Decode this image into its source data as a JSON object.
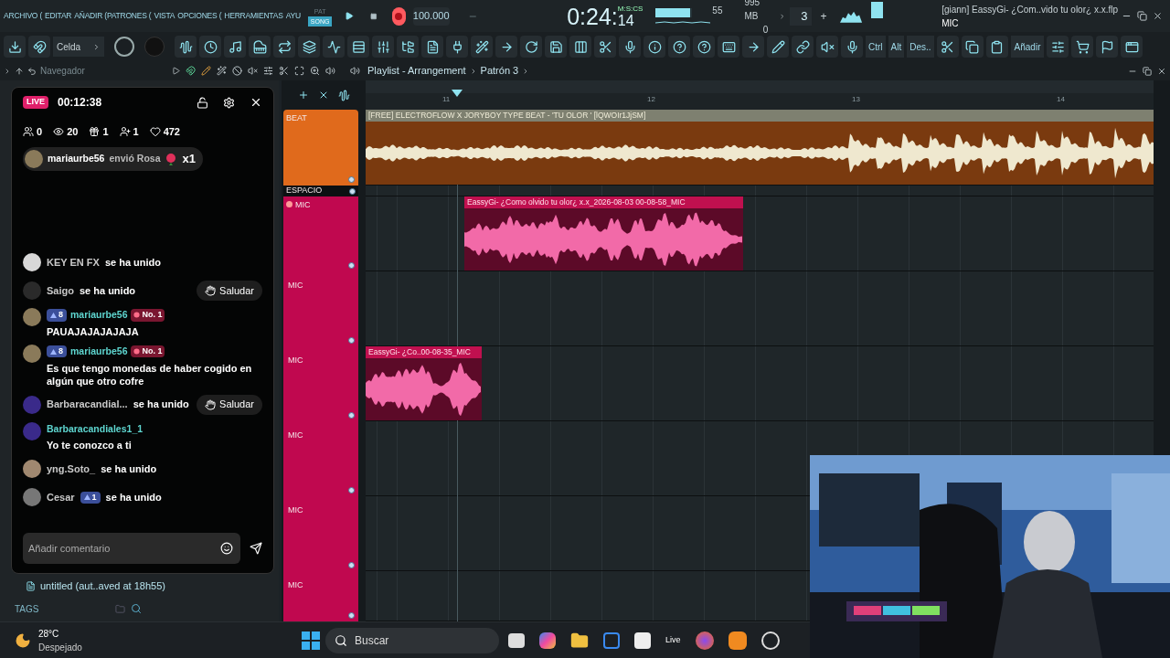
{
  "menu": [
    "ARCHIVO (",
    "EDITAR",
    "AÑADIR (PATRONES (",
    "VISTA",
    "OPCIONES (",
    "HERRAMIENTAS",
    "AYU"
  ],
  "transport": {
    "modes": [
      {
        "label": "PAT",
        "selected": false
      },
      {
        "label": "SONG",
        "selected": true
      }
    ],
    "tempo": "100.000"
  },
  "clock": {
    "time": "0:24:",
    "centis": "14",
    "unit_label": "M:S:CS"
  },
  "cpu": {
    "level": 0.95,
    "value": "55"
  },
  "memory": {
    "value": "995 MB",
    "polyphony": "0"
  },
  "pattern": {
    "number": "3",
    "add": "+"
  },
  "project": {
    "title": "[giann] EassyGi- ¿Com..vido tu olor¿ x.x.flp",
    "hint": "MIC"
  },
  "toolbar": {
    "snap": "Celda",
    "keys": [
      "Ctrl",
      "Alt",
      "Des.."
    ],
    "add": "Añadir"
  },
  "browser": {
    "title": "Navegador",
    "bottom_items": [
      "untitled (aut..aved at 18h55)"
    ],
    "tags": "TAGS"
  },
  "playlist": {
    "title": "Playlist - Arrangement",
    "pattern": "Patrón 3",
    "ruler": [
      "11",
      "12",
      "13",
      "14"
    ],
    "tracks": [
      {
        "name": "BEAT",
        "kind": "audio",
        "color": "#e06a1c",
        "clips": [
          {
            "name": "[FREE] ELECTROFLOW X JORYBOY TYPE BEAT - 'TU OLOR ' [lQWOIr1JjSM]"
          }
        ]
      },
      {
        "name": "ESPACIO",
        "kind": "spacer",
        "color": "#0d1012"
      },
      {
        "name": "MIC",
        "kind": "vocal",
        "color": "#c0084f",
        "clips": [
          {
            "name": "EassyGi- ¿Como olvido tu olor¿ x.x_2026-08-03 00-08-58_MIC"
          }
        ]
      },
      {
        "name": "MIC",
        "kind": "vocal",
        "color": "#c0084f"
      },
      {
        "name": "MIC",
        "kind": "vocal",
        "color": "#c0084f",
        "clips": [
          {
            "name": "EassyGi- ¿Co..00-08-35_MIC"
          }
        ]
      },
      {
        "name": "MIC",
        "kind": "vocal",
        "color": "#c0084f"
      },
      {
        "name": "MIC",
        "kind": "vocal",
        "color": "#c0084f"
      },
      {
        "name": "MIC",
        "kind": "vocal",
        "color": "#c0084f"
      }
    ]
  },
  "live": {
    "badge": "LIVE",
    "duration": "00:12:38",
    "stats": [
      {
        "kind": "members",
        "value": "0"
      },
      {
        "kind": "viewers",
        "value": "20"
      },
      {
        "kind": "gifts",
        "value": "1"
      },
      {
        "kind": "follows",
        "value": "1"
      },
      {
        "kind": "likes",
        "value": "472"
      }
    ],
    "gift": {
      "user": "mariaurbe56",
      "text": "envió Rosa",
      "count": "x1"
    },
    "feed": [
      {
        "kind": "join",
        "user": "KEY EN FX",
        "text": "se ha unido"
      },
      {
        "kind": "join",
        "user": "Saigo",
        "text": "se ha unido",
        "action": "Saludar"
      },
      {
        "kind": "message",
        "user": "mariaurbe56",
        "fan_level": "8",
        "rank": "No. 1",
        "text": "PAUAJAJAJAJAJA"
      },
      {
        "kind": "message",
        "user": "mariaurbe56",
        "fan_level": "8",
        "rank": "No. 1",
        "text": "Es que tengo monedas de haber cogido en algún que otro cofre"
      },
      {
        "kind": "join",
        "user": "Barbaracandial...",
        "text": "se ha unido",
        "action": "Saludar"
      },
      {
        "kind": "message",
        "user": "Barbaracandiales1_1",
        "text": "Yo te conozco a ti"
      },
      {
        "kind": "join",
        "user": "yng.Soto_",
        "text": "se ha unido"
      },
      {
        "kind": "join",
        "user": "Cesar",
        "fan_level": "1",
        "text": "se ha unido"
      }
    ],
    "comment": {
      "placeholder": "Añadir comentario"
    }
  },
  "taskbar": {
    "weather": {
      "temp": "28°C",
      "condition": "Despejado"
    },
    "search": {
      "placeholder": "Buscar"
    },
    "live_app": "Live"
  }
}
